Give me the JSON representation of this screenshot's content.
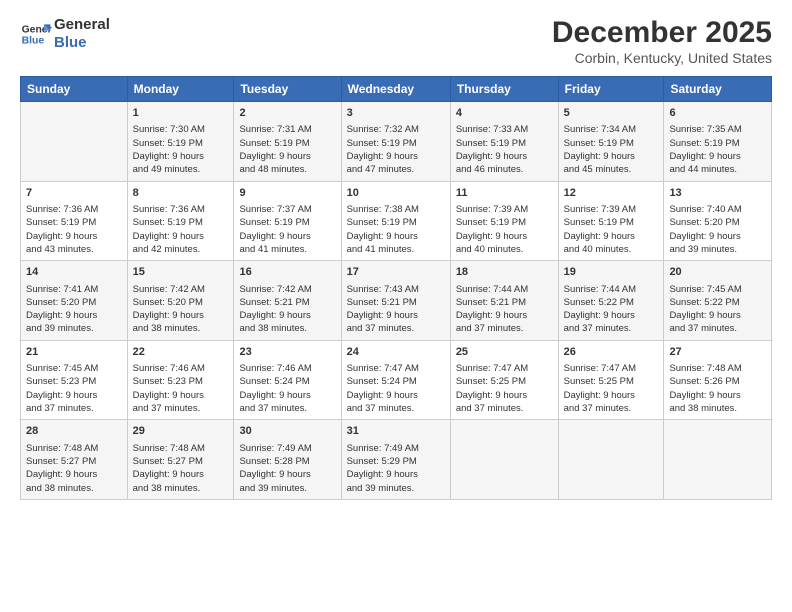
{
  "header": {
    "logo_line1": "General",
    "logo_line2": "Blue",
    "month_title": "December 2025",
    "location": "Corbin, Kentucky, United States"
  },
  "days_of_week": [
    "Sunday",
    "Monday",
    "Tuesday",
    "Wednesday",
    "Thursday",
    "Friday",
    "Saturday"
  ],
  "weeks": [
    [
      {
        "day": "",
        "content": ""
      },
      {
        "day": "1",
        "content": "Sunrise: 7:30 AM\nSunset: 5:19 PM\nDaylight: 9 hours\nand 49 minutes."
      },
      {
        "day": "2",
        "content": "Sunrise: 7:31 AM\nSunset: 5:19 PM\nDaylight: 9 hours\nand 48 minutes."
      },
      {
        "day": "3",
        "content": "Sunrise: 7:32 AM\nSunset: 5:19 PM\nDaylight: 9 hours\nand 47 minutes."
      },
      {
        "day": "4",
        "content": "Sunrise: 7:33 AM\nSunset: 5:19 PM\nDaylight: 9 hours\nand 46 minutes."
      },
      {
        "day": "5",
        "content": "Sunrise: 7:34 AM\nSunset: 5:19 PM\nDaylight: 9 hours\nand 45 minutes."
      },
      {
        "day": "6",
        "content": "Sunrise: 7:35 AM\nSunset: 5:19 PM\nDaylight: 9 hours\nand 44 minutes."
      }
    ],
    [
      {
        "day": "7",
        "content": "Sunrise: 7:36 AM\nSunset: 5:19 PM\nDaylight: 9 hours\nand 43 minutes."
      },
      {
        "day": "8",
        "content": "Sunrise: 7:36 AM\nSunset: 5:19 PM\nDaylight: 9 hours\nand 42 minutes."
      },
      {
        "day": "9",
        "content": "Sunrise: 7:37 AM\nSunset: 5:19 PM\nDaylight: 9 hours\nand 41 minutes."
      },
      {
        "day": "10",
        "content": "Sunrise: 7:38 AM\nSunset: 5:19 PM\nDaylight: 9 hours\nand 41 minutes."
      },
      {
        "day": "11",
        "content": "Sunrise: 7:39 AM\nSunset: 5:19 PM\nDaylight: 9 hours\nand 40 minutes."
      },
      {
        "day": "12",
        "content": "Sunrise: 7:39 AM\nSunset: 5:19 PM\nDaylight: 9 hours\nand 40 minutes."
      },
      {
        "day": "13",
        "content": "Sunrise: 7:40 AM\nSunset: 5:20 PM\nDaylight: 9 hours\nand 39 minutes."
      }
    ],
    [
      {
        "day": "14",
        "content": "Sunrise: 7:41 AM\nSunset: 5:20 PM\nDaylight: 9 hours\nand 39 minutes."
      },
      {
        "day": "15",
        "content": "Sunrise: 7:42 AM\nSunset: 5:20 PM\nDaylight: 9 hours\nand 38 minutes."
      },
      {
        "day": "16",
        "content": "Sunrise: 7:42 AM\nSunset: 5:21 PM\nDaylight: 9 hours\nand 38 minutes."
      },
      {
        "day": "17",
        "content": "Sunrise: 7:43 AM\nSunset: 5:21 PM\nDaylight: 9 hours\nand 37 minutes."
      },
      {
        "day": "18",
        "content": "Sunrise: 7:44 AM\nSunset: 5:21 PM\nDaylight: 9 hours\nand 37 minutes."
      },
      {
        "day": "19",
        "content": "Sunrise: 7:44 AM\nSunset: 5:22 PM\nDaylight: 9 hours\nand 37 minutes."
      },
      {
        "day": "20",
        "content": "Sunrise: 7:45 AM\nSunset: 5:22 PM\nDaylight: 9 hours\nand 37 minutes."
      }
    ],
    [
      {
        "day": "21",
        "content": "Sunrise: 7:45 AM\nSunset: 5:23 PM\nDaylight: 9 hours\nand 37 minutes."
      },
      {
        "day": "22",
        "content": "Sunrise: 7:46 AM\nSunset: 5:23 PM\nDaylight: 9 hours\nand 37 minutes."
      },
      {
        "day": "23",
        "content": "Sunrise: 7:46 AM\nSunset: 5:24 PM\nDaylight: 9 hours\nand 37 minutes."
      },
      {
        "day": "24",
        "content": "Sunrise: 7:47 AM\nSunset: 5:24 PM\nDaylight: 9 hours\nand 37 minutes."
      },
      {
        "day": "25",
        "content": "Sunrise: 7:47 AM\nSunset: 5:25 PM\nDaylight: 9 hours\nand 37 minutes."
      },
      {
        "day": "26",
        "content": "Sunrise: 7:47 AM\nSunset: 5:25 PM\nDaylight: 9 hours\nand 37 minutes."
      },
      {
        "day": "27",
        "content": "Sunrise: 7:48 AM\nSunset: 5:26 PM\nDaylight: 9 hours\nand 38 minutes."
      }
    ],
    [
      {
        "day": "28",
        "content": "Sunrise: 7:48 AM\nSunset: 5:27 PM\nDaylight: 9 hours\nand 38 minutes."
      },
      {
        "day": "29",
        "content": "Sunrise: 7:48 AM\nSunset: 5:27 PM\nDaylight: 9 hours\nand 38 minutes."
      },
      {
        "day": "30",
        "content": "Sunrise: 7:49 AM\nSunset: 5:28 PM\nDaylight: 9 hours\nand 39 minutes."
      },
      {
        "day": "31",
        "content": "Sunrise: 7:49 AM\nSunset: 5:29 PM\nDaylight: 9 hours\nand 39 minutes."
      },
      {
        "day": "",
        "content": ""
      },
      {
        "day": "",
        "content": ""
      },
      {
        "day": "",
        "content": ""
      }
    ]
  ]
}
